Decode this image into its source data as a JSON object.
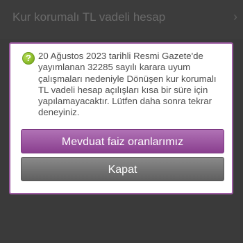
{
  "background": {
    "title": "Kur korumalı TL vadeli hesap",
    "chevron": "›"
  },
  "dialog": {
    "icon": "question-icon",
    "icon_glyph": "?",
    "message": "20 Ağustos 2023 tarihli Resmi Gazete'de yayımlanan 32285 sayılı karara uyum çalışmaları nedeniyle Dönüşen kur korumalı TL vadeli hesap açılışları kısa bir süre için yapılamayacaktır. Lütfen daha sonra tekrar deneyiniz.",
    "primary_button": "Mevduat faiz oranlarımız",
    "secondary_button": "Kapat"
  },
  "colors": {
    "accent": "#9c5aa1",
    "primary_button": "#9a4f9f",
    "secondary_button": "#6e6e6e",
    "icon_green": "#8cbc2b"
  }
}
